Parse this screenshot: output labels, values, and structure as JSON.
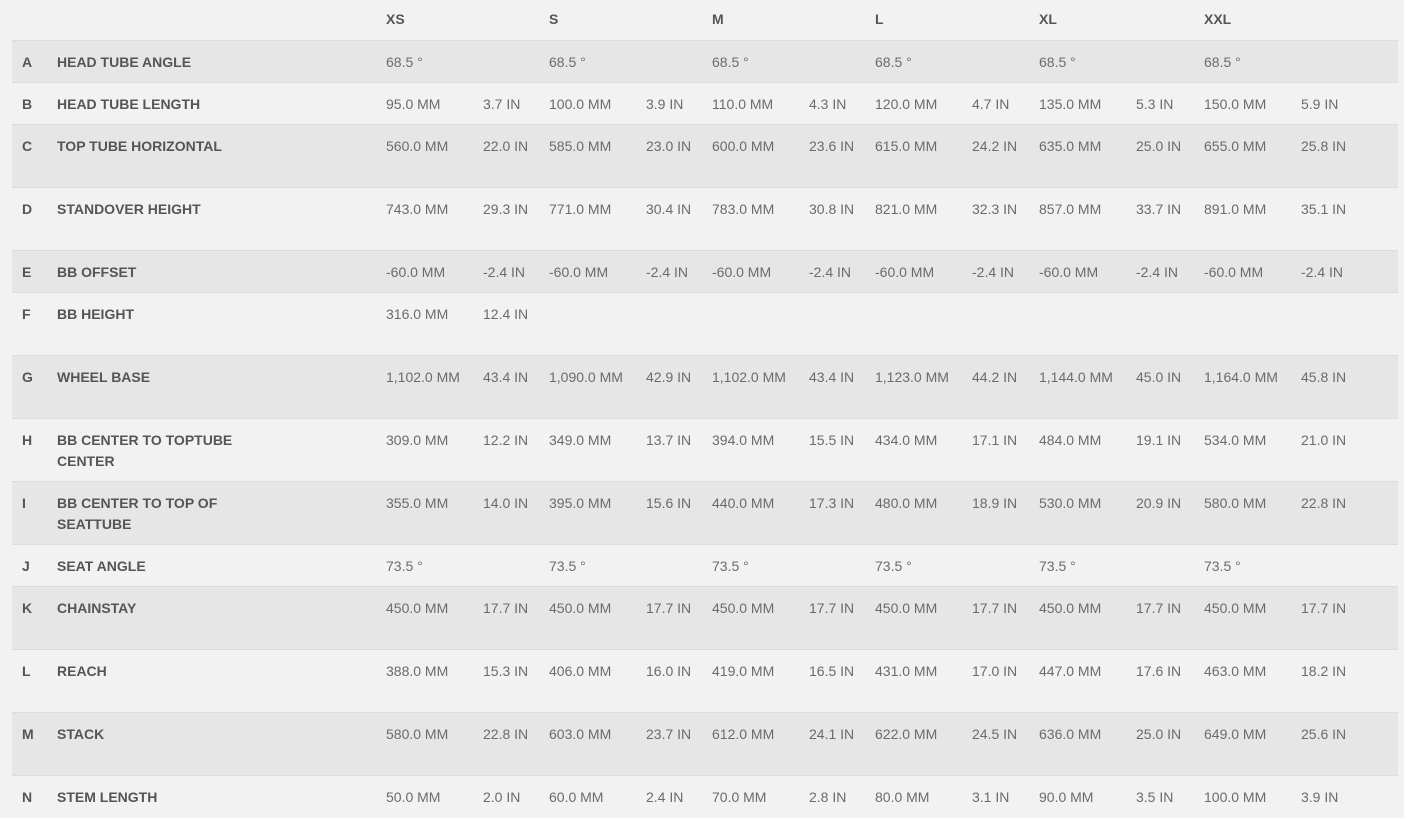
{
  "sizes": [
    "XS",
    "S",
    "M",
    "L",
    "XL",
    "XXL"
  ],
  "rows": [
    {
      "letter": "A",
      "name": "HEAD TUBE ANGLE",
      "shade": true,
      "lines": 1,
      "values": [
        [
          "68.5 °",
          ""
        ],
        [
          "68.5 °",
          ""
        ],
        [
          "68.5 °",
          ""
        ],
        [
          "68.5 °",
          ""
        ],
        [
          "68.5 °",
          ""
        ],
        [
          "68.5 °",
          ""
        ]
      ]
    },
    {
      "letter": "B",
      "name": "HEAD TUBE LENGTH",
      "shade": false,
      "lines": 1,
      "values": [
        [
          "95.0 MM",
          "3.7 IN"
        ],
        [
          "100.0 MM",
          "3.9 IN"
        ],
        [
          "110.0 MM",
          "4.3 IN"
        ],
        [
          "120.0 MM",
          "4.7 IN"
        ],
        [
          "135.0 MM",
          "5.3 IN"
        ],
        [
          "150.0 MM",
          "5.9 IN"
        ]
      ]
    },
    {
      "letter": "C",
      "name": "TOP TUBE HORIZONTAL",
      "shade": true,
      "lines": 2,
      "values": [
        [
          "560.0 MM",
          "22.0 IN"
        ],
        [
          "585.0 MM",
          "23.0 IN"
        ],
        [
          "600.0 MM",
          "23.6 IN"
        ],
        [
          "615.0 MM",
          "24.2 IN"
        ],
        [
          "635.0 MM",
          "25.0 IN"
        ],
        [
          "655.0 MM",
          "25.8 IN"
        ]
      ]
    },
    {
      "letter": "D",
      "name": "STANDOVER HEIGHT",
      "shade": false,
      "lines": 2,
      "values": [
        [
          "743.0 MM",
          "29.3 IN"
        ],
        [
          "771.0 MM",
          "30.4 IN"
        ],
        [
          "783.0 MM",
          "30.8 IN"
        ],
        [
          "821.0 MM",
          "32.3 IN"
        ],
        [
          "857.0 MM",
          "33.7 IN"
        ],
        [
          "891.0 MM",
          "35.1 IN"
        ]
      ]
    },
    {
      "letter": "E",
      "name": "BB OFFSET",
      "shade": true,
      "lines": 1,
      "values": [
        [
          "-60.0 MM",
          "-2.4 IN"
        ],
        [
          "-60.0 MM",
          "-2.4 IN"
        ],
        [
          "-60.0 MM",
          "-2.4 IN"
        ],
        [
          "-60.0 MM",
          "-2.4 IN"
        ],
        [
          "-60.0 MM",
          "-2.4 IN"
        ],
        [
          "-60.0 MM",
          "-2.4 IN"
        ]
      ]
    },
    {
      "letter": "F",
      "name": "BB HEIGHT",
      "shade": false,
      "lines": 2,
      "values": [
        [
          "316.0 MM",
          "12.4 IN"
        ],
        [
          "",
          ""
        ],
        [
          "",
          ""
        ],
        [
          "",
          ""
        ],
        [
          "",
          ""
        ],
        [
          "",
          ""
        ]
      ]
    },
    {
      "letter": "G",
      "name": "WHEEL BASE",
      "shade": true,
      "lines": 2,
      "values": [
        [
          "1,102.0 MM",
          "43.4 IN"
        ],
        [
          "1,090.0 MM",
          "42.9 IN"
        ],
        [
          "1,102.0 MM",
          "43.4 IN"
        ],
        [
          "1,123.0 MM",
          "44.2 IN"
        ],
        [
          "1,144.0 MM",
          "45.0 IN"
        ],
        [
          "1,164.0 MM",
          "45.8 IN"
        ]
      ]
    },
    {
      "letter": "H",
      "name": "BB CENTER TO TOPTUBE CENTER",
      "shade": false,
      "lines": 2,
      "values": [
        [
          "309.0 MM",
          "12.2 IN"
        ],
        [
          "349.0 MM",
          "13.7 IN"
        ],
        [
          "394.0 MM",
          "15.5 IN"
        ],
        [
          "434.0 MM",
          "17.1 IN"
        ],
        [
          "484.0 MM",
          "19.1 IN"
        ],
        [
          "534.0 MM",
          "21.0 IN"
        ]
      ]
    },
    {
      "letter": "I",
      "name": "BB CENTER TO TOP OF SEATTUBE",
      "shade": true,
      "lines": 2,
      "values": [
        [
          "355.0 MM",
          "14.0 IN"
        ],
        [
          "395.0 MM",
          "15.6 IN"
        ],
        [
          "440.0 MM",
          "17.3 IN"
        ],
        [
          "480.0 MM",
          "18.9 IN"
        ],
        [
          "530.0 MM",
          "20.9 IN"
        ],
        [
          "580.0 MM",
          "22.8 IN"
        ]
      ]
    },
    {
      "letter": "J",
      "name": "SEAT ANGLE",
      "shade": false,
      "lines": 1,
      "values": [
        [
          "73.5 °",
          ""
        ],
        [
          "73.5 °",
          ""
        ],
        [
          "73.5 °",
          ""
        ],
        [
          "73.5 °",
          ""
        ],
        [
          "73.5 °",
          ""
        ],
        [
          "73.5 °",
          ""
        ]
      ]
    },
    {
      "letter": "K",
      "name": "CHAINSTAY",
      "shade": true,
      "lines": 2,
      "values": [
        [
          "450.0 MM",
          "17.7 IN"
        ],
        [
          "450.0 MM",
          "17.7 IN"
        ],
        [
          "450.0 MM",
          "17.7 IN"
        ],
        [
          "450.0 MM",
          "17.7 IN"
        ],
        [
          "450.0 MM",
          "17.7 IN"
        ],
        [
          "450.0 MM",
          "17.7 IN"
        ]
      ]
    },
    {
      "letter": "L",
      "name": "REACH",
      "shade": false,
      "lines": 2,
      "values": [
        [
          "388.0 MM",
          "15.3 IN"
        ],
        [
          "406.0 MM",
          "16.0 IN"
        ],
        [
          "419.0 MM",
          "16.5 IN"
        ],
        [
          "431.0 MM",
          "17.0 IN"
        ],
        [
          "447.0 MM",
          "17.6 IN"
        ],
        [
          "463.0 MM",
          "18.2 IN"
        ]
      ]
    },
    {
      "letter": "M",
      "name": "STACK",
      "shade": true,
      "lines": 2,
      "values": [
        [
          "580.0 MM",
          "22.8 IN"
        ],
        [
          "603.0 MM",
          "23.7 IN"
        ],
        [
          "612.0 MM",
          "24.1 IN"
        ],
        [
          "622.0 MM",
          "24.5 IN"
        ],
        [
          "636.0 MM",
          "25.0 IN"
        ],
        [
          "649.0 MM",
          "25.6 IN"
        ]
      ]
    },
    {
      "letter": "N",
      "name": "STEM LENGTH",
      "shade": false,
      "lines": 1,
      "values": [
        [
          "50.0 MM",
          "2.0 IN"
        ],
        [
          "60.0 MM",
          "2.4 IN"
        ],
        [
          "70.0 MM",
          "2.8 IN"
        ],
        [
          "80.0 MM",
          "3.1 IN"
        ],
        [
          "90.0 MM",
          "3.5 IN"
        ],
        [
          "100.0 MM",
          "3.9 IN"
        ]
      ]
    }
  ]
}
